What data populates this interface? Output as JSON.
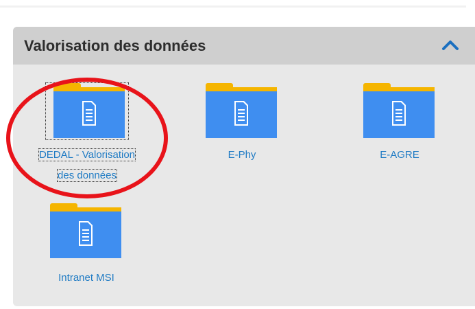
{
  "panel": {
    "title": "Valorisation des données",
    "collapse_icon": "chevron-up-icon"
  },
  "items": [
    {
      "label_line1": "DEDAL - Valorisation",
      "label_line2": "des données",
      "icon": "document-folder-icon",
      "selected": true
    },
    {
      "label_line1": "E-Phy",
      "icon": "document-folder-icon"
    },
    {
      "label_line1": "E-AGRE",
      "icon": "document-folder-icon"
    },
    {
      "label_line1": "Intranet MSI",
      "icon": "document-folder-icon"
    }
  ],
  "colors": {
    "folder_tab": "#f5b500",
    "folder_body": "#3f8ef0",
    "link_text": "#1f7bc4",
    "annotation_ring": "#e8131a",
    "chevron": "#1a6fc0"
  }
}
